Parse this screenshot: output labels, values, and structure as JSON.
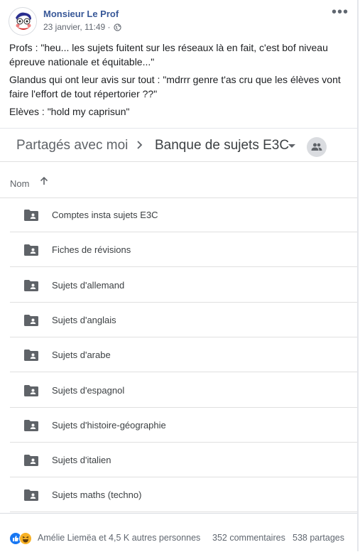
{
  "post": {
    "author": "Monsieur Le Prof",
    "date": "23 janvier, 11:49 ·",
    "more_icon": "more-dots-icon",
    "paragraphs": [
      "Profs : \"heu... les sujets fuitent sur les réseaux là en fait, c'est bof niveau épreuve nationale et équitable...\"",
      "Glandus qui ont leur avis sur tout : \"mdrrr genre t'as cru que les élèves vont faire l'effort de tout répertorier ??\"",
      "Elèves : \"hold my caprisun\""
    ]
  },
  "drive": {
    "breadcrumb_root": "Partagés avec moi",
    "breadcrumb_current": "Banque de sujets E3C",
    "column_name": "Nom",
    "folders": [
      "Comptes insta sujets E3C",
      "Fiches de révisions",
      "Sujets d'allemand",
      "Sujets d'anglais",
      "Sujets d'arabe",
      "Sujets d'espagnol",
      "Sujets d'histoire-géographie",
      "Sujets d'italien",
      "Sujets maths (techno)"
    ]
  },
  "footer": {
    "reactors": "Amélie Liemëa et 4,5 K autres personnes",
    "comments": "352 commentaires",
    "shares": "538 partages"
  },
  "colors": {
    "author": "#385898",
    "like": "#1877f2",
    "haha": "#f7b125"
  }
}
